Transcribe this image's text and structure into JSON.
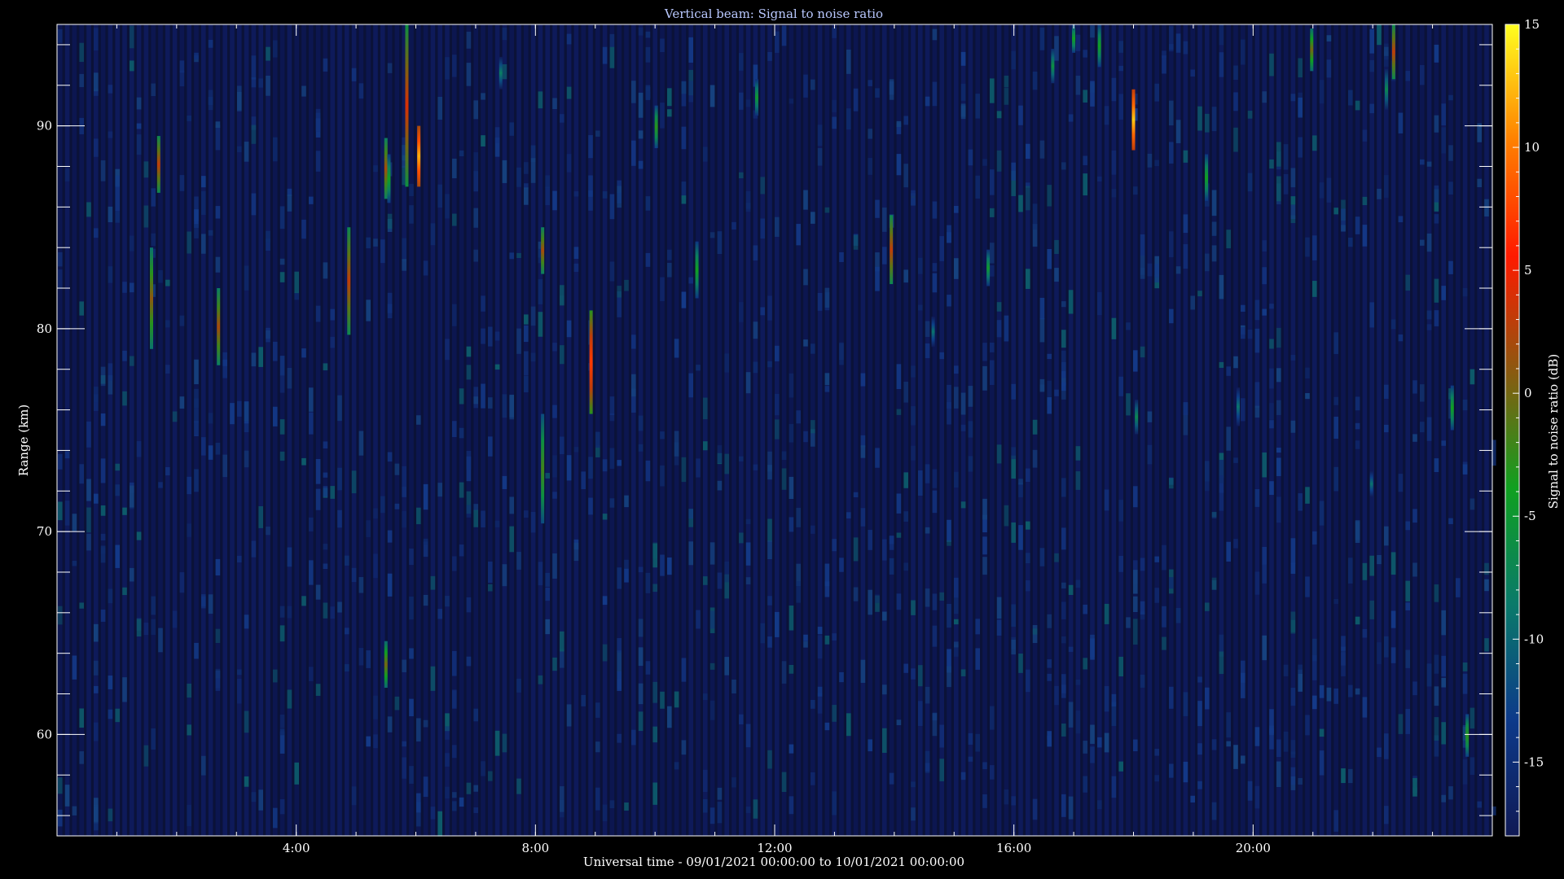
{
  "chart_data": {
    "type": "heatmap",
    "title": "Vertical beam: Signal to noise ratio",
    "xlabel": "Universal time - 09/01/2021 00:00:00 to 10/01/2021 00:00:00",
    "ylabel": "Range (km)",
    "colorbar_label": "Signal to noise ratio (dB)",
    "xlim_hours": [
      0,
      24
    ],
    "ylim_km": [
      55,
      95
    ],
    "clim_db": [
      -18,
      15
    ],
    "x_ticks": [
      {
        "hour": 4,
        "label": "4:00"
      },
      {
        "hour": 8,
        "label": "8:00"
      },
      {
        "hour": 12,
        "label": "12:00"
      },
      {
        "hour": 16,
        "label": "16:00"
      },
      {
        "hour": 20,
        "label": "20:00"
      }
    ],
    "y_ticks": [
      {
        "km": 60,
        "label": "60"
      },
      {
        "km": 70,
        "label": "70"
      },
      {
        "km": 80,
        "label": "80"
      },
      {
        "km": 90,
        "label": "90"
      }
    ],
    "colorbar_ticks": [
      {
        "db": 15,
        "label": "15"
      },
      {
        "db": 10,
        "label": "10"
      },
      {
        "db": 5,
        "label": "5"
      },
      {
        "db": 0,
        "label": "0"
      },
      {
        "db": -5,
        "label": "-5"
      },
      {
        "db": -10,
        "label": "-10"
      },
      {
        "db": -15,
        "label": "-15"
      }
    ],
    "colormap": [
      "#101a55",
      "#0d3a8a",
      "#0a7a6a",
      "#10a020",
      "#8a5a10",
      "#ff1a00",
      "#ff8000",
      "#ffff20"
    ],
    "background_snr_db": -15,
    "echoes": [
      {
        "hour": 1.7,
        "km_min": 86.7,
        "km_max": 89.5,
        "peak_db": 3
      },
      {
        "hour": 1.58,
        "km_min": 79.0,
        "km_max": 84.0,
        "peak_db": 1
      },
      {
        "hour": 2.7,
        "km_min": 78.2,
        "km_max": 82.0,
        "peak_db": 2
      },
      {
        "hour": 4.88,
        "km_min": 79.7,
        "km_max": 85.0,
        "peak_db": 3
      },
      {
        "hour": 5.5,
        "km_min": 86.4,
        "km_max": 89.4,
        "peak_db": 2
      },
      {
        "hour": 5.55,
        "km_min": 86.2,
        "km_max": 88.6,
        "peak_db": -4
      },
      {
        "hour": 5.5,
        "km_min": 62.3,
        "km_max": 64.6,
        "peak_db": 0
      },
      {
        "hour": 5.85,
        "km_min": 87.0,
        "km_max": 95.0,
        "peak_db": 4
      },
      {
        "hour": 6.05,
        "km_min": 87.0,
        "km_max": 90.0,
        "peak_db": 12
      },
      {
        "hour": 7.42,
        "km_min": 91.8,
        "km_max": 93.4,
        "peak_db": -8
      },
      {
        "hour": 8.12,
        "km_min": 82.7,
        "km_max": 85.0,
        "peak_db": 2
      },
      {
        "hour": 8.12,
        "km_min": 70.4,
        "km_max": 75.8,
        "peak_db": -2
      },
      {
        "hour": 8.93,
        "km_min": 75.8,
        "km_max": 80.9,
        "peak_db": 7
      },
      {
        "hour": 10.02,
        "km_min": 88.9,
        "km_max": 91.0,
        "peak_db": -3
      },
      {
        "hour": 10.7,
        "km_min": 81.5,
        "km_max": 84.3,
        "peak_db": -4
      },
      {
        "hour": 11.7,
        "km_min": 90.5,
        "km_max": 92.3,
        "peak_db": -5
      },
      {
        "hour": 13.95,
        "km_min": 82.2,
        "km_max": 85.6,
        "peak_db": 3
      },
      {
        "hour": 14.65,
        "km_min": 79.1,
        "km_max": 80.6,
        "peak_db": -9
      },
      {
        "hour": 15.57,
        "km_min": 82.1,
        "km_max": 83.9,
        "peak_db": -5
      },
      {
        "hour": 16.65,
        "km_min": 92.1,
        "km_max": 93.8,
        "peak_db": -6
      },
      {
        "hour": 17.0,
        "km_min": 93.6,
        "km_max": 95.0,
        "peak_db": -4
      },
      {
        "hour": 17.43,
        "km_min": 92.9,
        "km_max": 95.0,
        "peak_db": -4
      },
      {
        "hour": 18.0,
        "km_min": 88.8,
        "km_max": 91.8,
        "peak_db": 13
      },
      {
        "hour": 18.05,
        "km_min": 74.8,
        "km_max": 76.5,
        "peak_db": -7
      },
      {
        "hour": 19.22,
        "km_min": 86.3,
        "km_max": 88.6,
        "peak_db": -4
      },
      {
        "hour": 19.75,
        "km_min": 75.2,
        "km_max": 77.1,
        "peak_db": -9
      },
      {
        "hour": 20.98,
        "km_min": 92.7,
        "km_max": 94.8,
        "peak_db": 0
      },
      {
        "hour": 21.98,
        "km_min": 71.7,
        "km_max": 73.0,
        "peak_db": -9
      },
      {
        "hour": 22.23,
        "km_min": 90.8,
        "km_max": 92.8,
        "peak_db": -7
      },
      {
        "hour": 22.35,
        "km_min": 92.3,
        "km_max": 95.0,
        "peak_db": 3
      },
      {
        "hour": 23.33,
        "km_min": 75.0,
        "km_max": 77.2,
        "peak_db": -4
      },
      {
        "hour": 23.58,
        "km_min": 58.9,
        "km_max": 61.0,
        "peak_db": -3
      }
    ]
  }
}
